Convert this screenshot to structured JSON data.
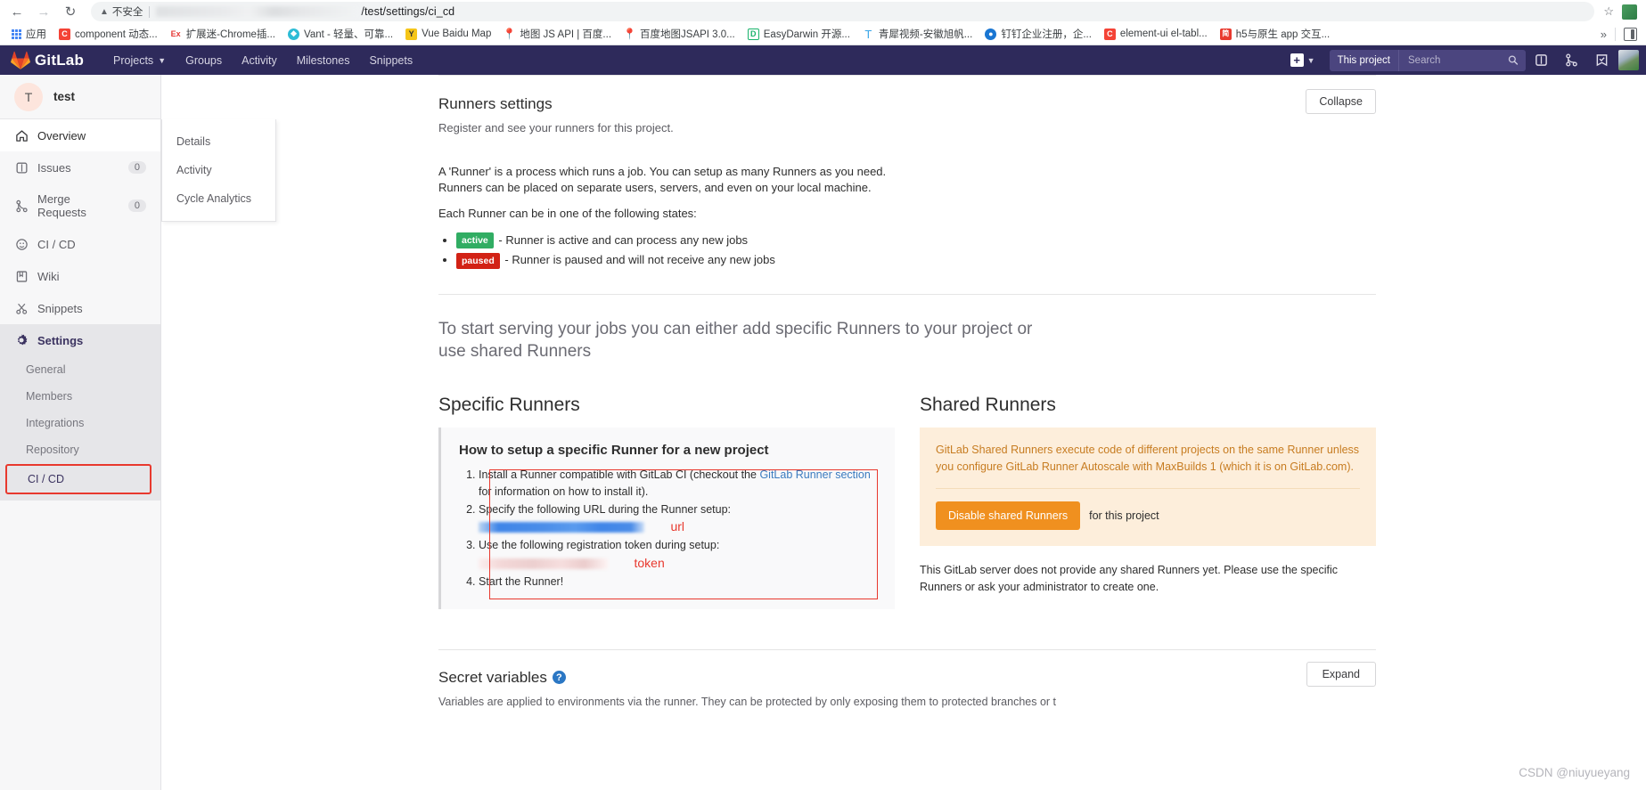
{
  "browser": {
    "back_icon": "back-arrow-icon",
    "forward_icon": "forward-arrow-icon",
    "reload_icon": "reload-icon",
    "not_secure_label": "不安全",
    "url_visible_tail": "/test/settings/ci_cd",
    "star_icon": "bookmark-star-icon",
    "apps_label": "应用",
    "overflow_label": "»",
    "bookmarks": [
      {
        "label": "component 动态...",
        "letter": "C",
        "color": "#f44336"
      },
      {
        "label": "扩展迷-Chrome插...",
        "letter": "Ex",
        "color": "#e53935"
      },
      {
        "label": "Vant - 轻量、可靠...",
        "letter": "V",
        "color": "#2dbcd6"
      },
      {
        "label": "Vue Baidu Map",
        "letter": "Y",
        "color": "#f5c518"
      },
      {
        "label": "地图 JS API | 百度...",
        "letter": "P",
        "color": "#e8392e"
      },
      {
        "label": "百度地图JSAPI 3.0...",
        "letter": "P",
        "color": "#e8392e"
      },
      {
        "label": "EasyDarwin 开源...",
        "letter": "D",
        "color": "#19b36b"
      },
      {
        "label": "青犀视频-安徽旭帆...",
        "letter": "T",
        "color": "#3aa6e8"
      },
      {
        "label": "钉钉企业注册，企...",
        "letter": "D",
        "color": "#1a76d2"
      },
      {
        "label": "element-ui el-tabl...",
        "letter": "C",
        "color": "#f44336"
      },
      {
        "label": "h5与原生 app 交互...",
        "letter": "简",
        "color": "#e8392e"
      }
    ]
  },
  "gitlab_nav": {
    "brand": "GitLab",
    "items": [
      {
        "label": "Projects",
        "has_caret": true
      },
      {
        "label": "Groups",
        "has_caret": false
      },
      {
        "label": "Activity",
        "has_caret": false
      },
      {
        "label": "Milestones",
        "has_caret": false
      },
      {
        "label": "Snippets",
        "has_caret": false
      }
    ],
    "plus_label": "+",
    "search_scope": "This project",
    "search_placeholder": "Search",
    "icons": [
      "issues-icon",
      "merge-requests-icon",
      "todos-icon",
      "user-avatar"
    ]
  },
  "sidebar": {
    "project_initial": "T",
    "project_name": "test",
    "items": [
      {
        "label": "Overview",
        "icon": "home-icon",
        "badge": null,
        "state": "active-white"
      },
      {
        "label": "Issues",
        "icon": "issues-icon",
        "badge": "0",
        "state": ""
      },
      {
        "label": "Merge Requests",
        "icon": "merge-request-icon",
        "badge": "0",
        "state": ""
      },
      {
        "label": "CI / CD",
        "icon": "rocket-icon",
        "badge": null,
        "state": ""
      },
      {
        "label": "Wiki",
        "icon": "book-icon",
        "badge": null,
        "state": ""
      },
      {
        "label": "Snippets",
        "icon": "scissors-icon",
        "badge": null,
        "state": ""
      },
      {
        "label": "Settings",
        "icon": "gear-icon",
        "badge": null,
        "state": "active-gray"
      }
    ],
    "settings_sub": [
      {
        "label": "General",
        "selected": false
      },
      {
        "label": "Members",
        "selected": false
      },
      {
        "label": "Integrations",
        "selected": false
      },
      {
        "label": "Repository",
        "selected": false
      },
      {
        "label": "CI / CD",
        "selected": true
      }
    ],
    "flyout": [
      {
        "label": "Details"
      },
      {
        "label": "Activity"
      },
      {
        "label": "Cycle Analytics"
      }
    ]
  },
  "runners": {
    "title": "Runners settings",
    "subtitle": "Register and see your runners for this project.",
    "collapse_label": "Collapse",
    "desc_line1": "A 'Runner' is a process which runs a job. You can setup as many Runners as you need.",
    "desc_line2": "Runners can be placed on separate users, servers, and even on your local machine.",
    "states_intro": "Each Runner can be in one of the following states:",
    "state_active_tag": "active",
    "state_active_text": "- Runner is active and can process any new jobs",
    "state_paused_tag": "paused",
    "state_paused_text": "- Runner is paused and will not receive any new jobs",
    "lead": "To start serving your jobs you can either add specific Runners to your project or use shared Runners"
  },
  "specific": {
    "title": "Specific Runners",
    "callout_heading": "How to setup a specific Runner for a new project",
    "step1_a": "Install a Runner compatible with GitLab CI (checkout the ",
    "step1_link": "GitLab Runner section",
    "step1_b": " for information on how to install it).",
    "step2": "Specify the following URL during the Runner setup:",
    "url_annotation": "url",
    "step3": "Use the following registration token during setup:",
    "token_annotation": "token",
    "step4": "Start the Runner!"
  },
  "shared": {
    "title": "Shared Runners",
    "warning": "GitLab Shared Runners execute code of different projects on the same Runner unless you configure GitLab Runner Autoscale with MaxBuilds 1 (which it is on GitLab.com).",
    "disable_button": "Disable shared Runners",
    "for_this_project": "for this project",
    "note": "This GitLab server does not provide any shared Runners yet. Please use the specific Runners or ask your administrator to create one."
  },
  "secret_variables": {
    "title": "Secret variables",
    "help_icon": "help-circle-icon",
    "expand_label": "Expand",
    "description": "Variables are applied to environments via the runner. They can be protected by only exposing them to protected branches or t"
  },
  "watermark": "CSDN @niuyueyang",
  "colors": {
    "gitlab_navy": "#2e2a5b",
    "accent_red": "#e8392e",
    "warning_orange": "#f0901f",
    "link_blue": "#3b7bbf",
    "tag_green": "#31ad63",
    "tag_red": "#d22215"
  }
}
